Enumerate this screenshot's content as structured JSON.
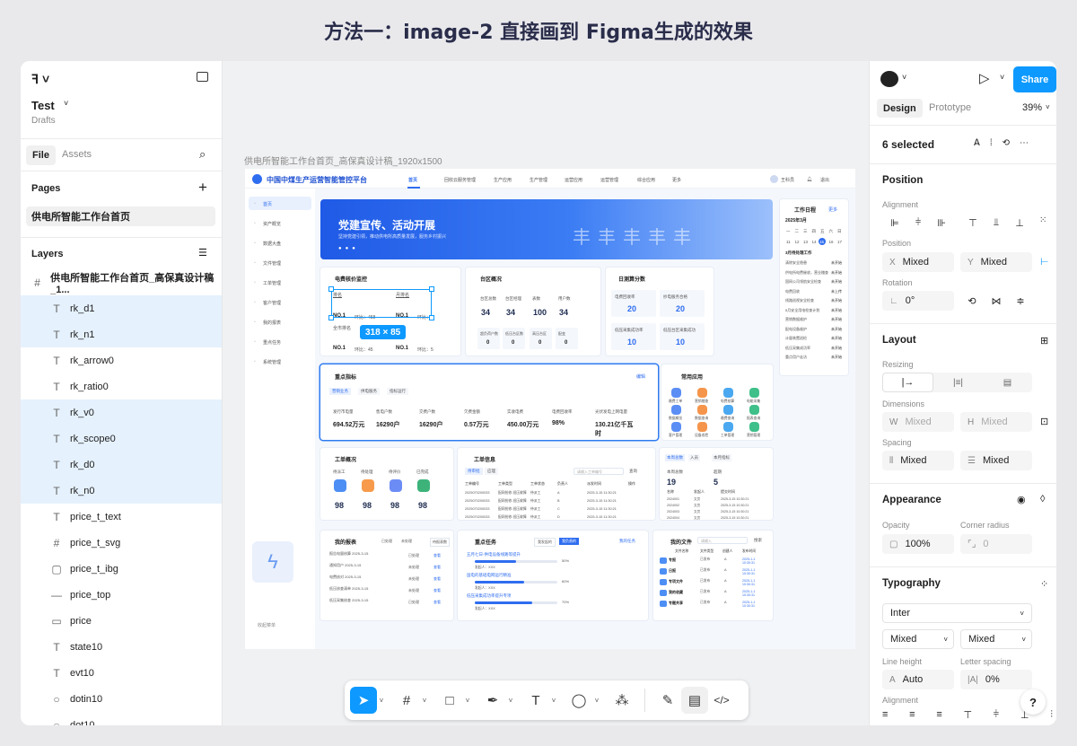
{
  "header": {
    "title": "方法一：image-2 直接画到 Figma生成的效果"
  },
  "left": {
    "project": "Test",
    "drafts": "Drafts",
    "tabs": [
      "File",
      "Assets"
    ],
    "pages_label": "Pages",
    "page_item": "供电所智能工作台首页",
    "layers_label": "Layers",
    "frame_layer": "供电所智能工作台首页_高保真设计稿_1...",
    "layers": [
      {
        "icon": "T",
        "name": "rk_d1",
        "sel": true
      },
      {
        "icon": "T",
        "name": "rk_n1",
        "sel": true
      },
      {
        "icon": "T",
        "name": "rk_arrow0",
        "sel": false
      },
      {
        "icon": "T",
        "name": "rk_ratio0",
        "sel": false
      },
      {
        "icon": "T",
        "name": "rk_v0",
        "sel": true
      },
      {
        "icon": "T",
        "name": "rk_scope0",
        "sel": true
      },
      {
        "icon": "T",
        "name": "rk_d0",
        "sel": true
      },
      {
        "icon": "T",
        "name": "rk_n0",
        "sel": true
      },
      {
        "icon": "T",
        "name": "price_t_text",
        "sel": false
      },
      {
        "icon": "#",
        "name": "price_t_svg",
        "sel": false
      },
      {
        "icon": "▢",
        "name": "price_t_ibg",
        "sel": false
      },
      {
        "icon": "—",
        "name": "price_top",
        "sel": false
      },
      {
        "icon": "▭",
        "name": "price",
        "sel": false
      },
      {
        "icon": "T",
        "name": "state10",
        "sel": false
      },
      {
        "icon": "T",
        "name": "evt10",
        "sel": false
      },
      {
        "icon": "○",
        "name": "dotin10",
        "sel": false
      },
      {
        "icon": "○",
        "name": "dot10",
        "sel": false
      }
    ]
  },
  "canvas": {
    "frame_label": "供电所智能工作台首页_高保真设计稿_1920x1500",
    "selection_size": "318 × 85",
    "app": {
      "title": "中国中煤生产运营智能管控平台",
      "nav": [
        "首页",
        "回收云服务管理",
        "生产应用",
        "生产管理",
        "运营应用",
        "运营管理",
        "综合应用",
        "更多"
      ],
      "user": "王科员",
      "logout": "退出",
      "sidebar": [
        "首页",
        "资产概览",
        "数据大盘",
        "文件管理",
        "工单管理",
        "客户管理",
        "我的报表",
        "重点任务",
        "系统管理"
      ],
      "collapse": "收起菜单",
      "banner": {
        "title": "党建宣传、活动开展",
        "sub": "坚持党建引领，推动供电所高质量发展，服务乡村振兴"
      },
      "c1": {
        "title": "电费核价监控",
        "r1": [
          "NO.1",
          "环比：458",
          "NO.1",
          "环比：2"
        ],
        "r2": [
          "全市排名",
          "电位排名"
        ],
        "r3": [
          "NO.1",
          "环比：45",
          "NO.1",
          "环比：5"
        ],
        "head": [
          "排名",
          "月排名"
        ]
      },
      "c2": {
        "title": "台区概况",
        "labels": [
          "台区总数",
          "台区经理",
          "表数",
          "用户数"
        ],
        "vals": [
          "34",
          "34",
          "100",
          "34"
        ],
        "sublabels": [
          "超负荷户数",
          "低压台区数",
          "高压台区",
          "配变"
        ],
        "subvals": [
          "0",
          "0",
          "0",
          "0"
        ]
      },
      "c3": {
        "title": "日测算分数",
        "labels": [
          "电费回收率",
          "抄电服务合格",
          "低压采集成功率",
          "低压台区采集成功"
        ],
        "vals": [
          "20",
          "20",
          "10",
          "10"
        ]
      },
      "cal": {
        "title": "工作日程",
        "more": "更多",
        "month": "2025年3月",
        "wk": [
          "一",
          "二",
          "三",
          "四",
          "五",
          "六",
          "日"
        ],
        "d1": [
          "3",
          "4",
          "5",
          "6",
          "7",
          "8",
          "9"
        ],
        "d2": [
          "11",
          "12",
          "13",
          "14",
          "15",
          "16",
          "17"
        ],
        "today": "15",
        "sub": "3月待处理工作",
        "items": [
          [
            "清除安全隐患",
            "未开始"
          ],
          [
            "供电所电费催收，营业稽查",
            "未开始"
          ],
          [
            "国网公司领航安全检查",
            "未开始"
          ],
          [
            "电费回收",
            "未上传"
          ],
          [
            "线路巡视安全检查",
            "未开始"
          ],
          [
            "5月安全用电检查计划",
            "未开始"
          ],
          [
            "营销数据维护",
            "未开始"
          ],
          [
            "配电设备维护",
            "未开始"
          ],
          [
            "计量装置巡检",
            "未开始"
          ],
          [
            "低压采集成功率",
            "未开始"
          ],
          [
            "重点用户走访",
            "未开始"
          ]
        ]
      },
      "kpi": {
        "title": "重点指标",
        "more": "编辑",
        "tabs": [
          "营销业务",
          "供电服务",
          "指标运行"
        ],
        "labels": [
          "发行市电量",
          "售电户数",
          "交费户数",
          "欠费金额",
          "实收电费",
          "电费回收率",
          "光伏发电上网电量"
        ],
        "vals": [
          "694.52万元",
          "16290户",
          "16290户",
          "0.57万元",
          "450.00万元",
          "98%",
          "130.21亿千瓦时"
        ]
      },
      "apps": {
        "title": "常用应用",
        "items": [
          "缴费工单",
          "营销稽查",
          "电费核算",
          "电能采集",
          "数据概览",
          "数据查询",
          "缴费查询",
          "报表查询",
          "客户管理",
          "设备巡检",
          "工单管理",
          "营销管理"
        ]
      },
      "wo": {
        "title": "工单概况",
        "labels": [
          "待派工",
          "待处理",
          "待评价",
          "已完成"
        ],
        "vals": [
          "98",
          "98",
          "98",
          "98"
        ]
      },
      "wi": {
        "title": "工单信息",
        "tabs": [
          "待审批",
          "应理"
        ],
        "search": "请输入工单编号",
        "btn": "查询",
        "cols": [
          "工单编号",
          "工单类型",
          "工单状态",
          "负责人",
          "派发时间",
          "操作"
        ],
        "rows": [
          [
            "2025070200033",
            "配网抢修-低压故障",
            "待派工",
            "A",
            "2025-3-15 11:30:21"
          ],
          [
            "2025070200033",
            "配网抢修-低压故障",
            "待派工",
            "B",
            "2025-3-15 11:30:21"
          ],
          [
            "2025070200033",
            "配网抢修-低压故障",
            "待派工",
            "C",
            "2025-3-15 11:30:21"
          ],
          [
            "2025070200033",
            "配网抢修-低压故障",
            "待派工",
            "D",
            "2025-3-15 11:30:21"
          ]
        ]
      },
      "stat": {
        "tabs": [
          "本周总数",
          "入员",
          "本月指标"
        ],
        "l1": "本周总数",
        "v1": "19",
        "l2": "超期",
        "v2": "5",
        "cols": [
          "名称",
          "发起人",
          "提交时间"
        ],
        "rows": [
          [
            "2024001",
            "文员",
            "2025-3-15 10:30:21"
          ],
          [
            "2024002",
            "文员",
            "2025-3-15 10:30:21"
          ],
          [
            "2024003",
            "文员",
            "2025-3-15 10:30:21"
          ],
          [
            "2024004",
            "文员",
            "2025-3-15 10:30:21"
          ]
        ]
      },
      "rep": {
        "title": "我的报表",
        "legend": [
          "已处理",
          "未处理"
        ],
        "btn": "待报表数",
        "rows": [
          [
            "报告电量核算 2025-3-15",
            "已处理",
            "查看"
          ],
          [
            "通知用户 2025-3-15",
            "未处理",
            "查看"
          ],
          [
            "电费核对 2025-3-15",
            "未处理",
            "查看"
          ],
          [
            "低压核查清单 2025-3-15",
            "未处理",
            "查看"
          ],
          [
            "低压采集核查 2025-3-15",
            "已处理",
            "查看"
          ]
        ]
      },
      "tasks": {
        "title": "重点任务",
        "tabs": [
          "我发起的",
          "我负责的"
        ],
        "more": "我的任务",
        "items": [
          {
            "name": "五月七日-供电设备线路等提升",
            "pct": "50%",
            "p": 0.5
          },
          {
            "name": "国电的基础电网运行精准",
            "pct": "60%",
            "p": 0.6
          },
          {
            "name": "低压采集成功率提升专项",
            "pct": "70%",
            "p": 0.7
          }
        ],
        "meta": "发起人：XXX"
      },
      "files": {
        "title": "我的文件",
        "search": "请输入",
        "btn": "搜索",
        "cols": [
          "文件名称",
          "文件类型",
          "创建人",
          "发布时间"
        ],
        "rows": [
          [
            "专报",
            "已发布",
            "A",
            "2025-1-1 10:30:31"
          ],
          [
            "日报",
            "已发布",
            "A",
            "2025-1-1 10:30:31"
          ],
          [
            "专项文件",
            "已发布",
            "A",
            "2025-1-1 10:30:31"
          ],
          [
            "我的收藏",
            "已发布",
            "A",
            "2025-1-1 10:30:31"
          ],
          [
            "专题共享",
            "已发布",
            "A",
            "2025-1-1 10:30:31"
          ]
        ]
      }
    }
  },
  "right": {
    "share": "Share",
    "tabs": [
      "Design",
      "Prototype"
    ],
    "zoom": "39%",
    "selected": "6 selected",
    "position": "Position",
    "alignment": "Alignment",
    "pos_label": "Position",
    "x": "Mixed",
    "y": "Mixed",
    "rotation": "Rotation",
    "rot": "0°",
    "layout": "Layout",
    "resizing": "Resizing",
    "dimensions": "Dimensions",
    "w": "Mixed",
    "h": "Mixed",
    "spacing": "Spacing",
    "sp1": "Mixed",
    "sp2": "Mixed",
    "appearance": "Appearance",
    "opacity_label": "Opacity",
    "radius_label": "Corner radius",
    "opacity": "100%",
    "radius": "0",
    "typography": "Typography",
    "font": "Inter",
    "weight": "Mixed",
    "size": "Mixed",
    "lh_label": "Line height",
    "ls_label": "Letter spacing",
    "lh": "Auto",
    "ls": "0%",
    "alignment2": "Alignment",
    "help": "?"
  }
}
